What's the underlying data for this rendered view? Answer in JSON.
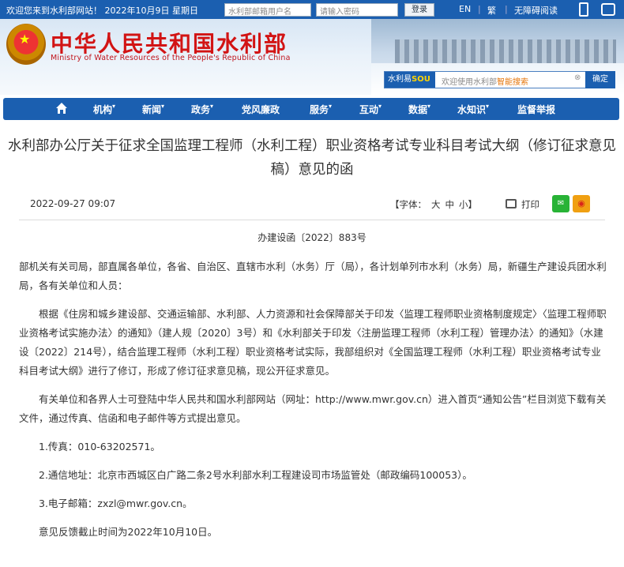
{
  "topbar": {
    "welcome": "欢迎您来到水利部网站！ 2022年10月9日 星期日",
    "username_placeholder": "水利部邮箱用户名",
    "password_placeholder": "请输入密码",
    "login_label": "登录",
    "english": "EN",
    "traditional": "繁",
    "accessible": "无障碍阅读"
  },
  "header": {
    "title": "中华人民共和国水利部",
    "subtitle": "Ministry of Water Resources of the People's Republic of China",
    "search_brand": "水利易",
    "search_brand_accent": "SOU",
    "search_placeholder_prefix": "欢迎使用水利部",
    "search_placeholder_highlight": "智能搜索",
    "search_clear": "⊗",
    "search_button": "确定"
  },
  "nav": {
    "items": [
      {
        "label": "机构",
        "arrow": "▾"
      },
      {
        "label": "新闻",
        "arrow": "▾"
      },
      {
        "label": "政务",
        "arrow": "▾"
      },
      {
        "label": "党风廉政",
        "arrow": ""
      },
      {
        "label": "服务",
        "arrow": "▾"
      },
      {
        "label": "互动",
        "arrow": "▾"
      },
      {
        "label": "数据",
        "arrow": "▾"
      },
      {
        "label": "水知识",
        "arrow": "▾"
      },
      {
        "label": "监督举报",
        "arrow": ""
      }
    ]
  },
  "article": {
    "title": "水利部办公厅关于征求全国监理工程师（水利工程）职业资格考试专业科目考试大纲（修订征求意见稿）意见的函",
    "date": "2022-09-27 09:07",
    "fontsize_label": "【字体：",
    "fontsize_large": "大",
    "fontsize_medium": "中",
    "fontsize_small": "小",
    "fontsize_end": "】",
    "print_label": "打印",
    "doc_number": "办建设函〔2022〕883号",
    "paragraphs": [
      "部机关有关司局，部直属各单位，各省、自治区、直辖市水利（水务）厅（局），各计划单列市水利（水务）局，新疆生产建设兵团水利局，各有关单位和人员：",
      "根据《住房和城乡建设部、交通运输部、水利部、人力资源和社会保障部关于印发〈监理工程师职业资格制度规定〉〈监理工程师职业资格考试实施办法〉的通知》（建人规〔2020〕3号）和《水利部关于印发〈注册监理工程师（水利工程）管理办法〉的通知》（水建设〔2022〕214号），结合监理工程师（水利工程）职业资格考试实际，我部组织对《全国监理工程师（水利工程）职业资格考试专业科目考试大纲》进行了修订，形成了修订征求意见稿，现公开征求意见。",
      "有关单位和各界人士可登陆中华人民共和国水利部网站（网址：http://www.mwr.gov.cn）进入首页“通知公告”栏目浏览下载有关文件，通过传真、信函和电子邮件等方式提出意见。",
      "1.传真：010-63202571。",
      "2.通信地址：北京市西城区白广路二条2号水利部水利工程建设司市场监管处（邮政编码100053）。",
      "3.电子邮箱：zxzl@mwr.gov.cn。",
      "意见反馈截止时间为2022年10月10日。"
    ]
  }
}
